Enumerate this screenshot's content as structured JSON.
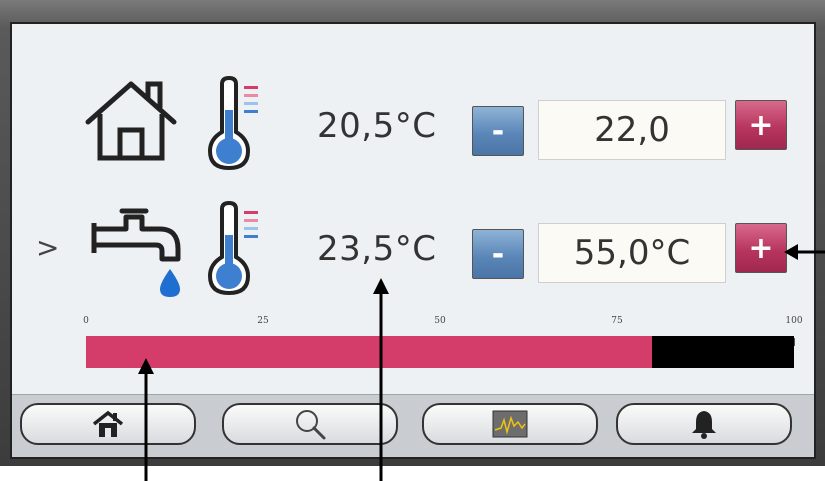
{
  "rows": [
    {
      "id": "room",
      "selected": false,
      "icon": "house-icon",
      "reading": "20,5°C",
      "setpoint": "22,0",
      "minus_label": "-",
      "plus_label": "+"
    },
    {
      "id": "water",
      "selected": true,
      "selector_glyph": ">",
      "icon": "faucet-icon",
      "reading": "23,5°C",
      "setpoint": "55,0°C",
      "minus_label": "-",
      "plus_label": "+"
    }
  ],
  "scale": {
    "labels": [
      "0",
      "25",
      "50",
      "75",
      "100"
    ],
    "level_percent": 80,
    "fill_color": "#d43c6a"
  },
  "nav": [
    {
      "name": "home",
      "icon": "home-icon"
    },
    {
      "name": "search",
      "icon": "magnifier-icon"
    },
    {
      "name": "trend",
      "icon": "chart-icon"
    },
    {
      "name": "alarm",
      "icon": "bell-icon"
    }
  ],
  "colors": {
    "minus": "#5b87b8",
    "plus": "#b8355e",
    "thermometer": "#3f7fd0"
  }
}
